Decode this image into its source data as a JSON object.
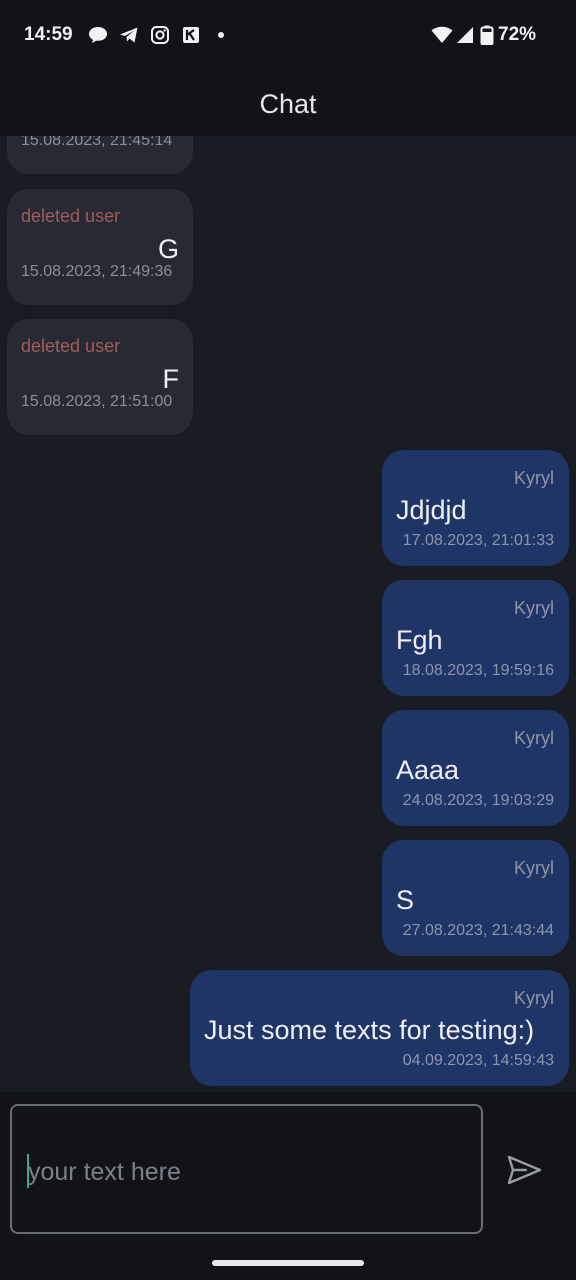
{
  "status_bar": {
    "time": "14:59",
    "battery": "72%",
    "icons": [
      "chat-bubble-icon",
      "telegram-icon",
      "instagram-icon",
      "app-icon",
      "notification-dot-icon",
      "wifi-icon",
      "signal-icon",
      "battery-icon"
    ]
  },
  "app_bar": {
    "title": "Chat"
  },
  "messages": [
    {
      "direction": "incoming",
      "timestamp": "15.08.2023, 21:45:14"
    },
    {
      "direction": "incoming",
      "sender": "deleted user",
      "text": "G",
      "timestamp": "15.08.2023, 21:49:36"
    },
    {
      "direction": "incoming",
      "sender": "deleted user",
      "text": "F",
      "timestamp": "15.08.2023, 21:51:00"
    },
    {
      "direction": "outgoing",
      "sender": "Kyryl",
      "text": "Jdjdjd",
      "timestamp": "17.08.2023, 21:01:33"
    },
    {
      "direction": "outgoing",
      "sender": "Kyryl",
      "text": "Fgh",
      "timestamp": "18.08.2023, 19:59:16"
    },
    {
      "direction": "outgoing",
      "sender": "Kyryl",
      "text": "Aaaa",
      "timestamp": "24.08.2023, 19:03:29"
    },
    {
      "direction": "outgoing",
      "sender": "Kyryl",
      "text": "S",
      "timestamp": "27.08.2023, 21:43:44"
    },
    {
      "direction": "outgoing",
      "sender": "Kyryl",
      "text": "Just some texts for testing:)",
      "timestamp": "04.09.2023, 14:59:43"
    }
  ],
  "composer": {
    "value": "",
    "placeholder": "your text here",
    "send_icon": "send-icon"
  },
  "colors": {
    "background": "#1a1c24",
    "bars": "#121318",
    "incoming_bubble": "#272a33",
    "outgoing_bubble": "#1f3566",
    "deleted_user_name": "#a45c5c",
    "caret": "#3fa68f"
  }
}
